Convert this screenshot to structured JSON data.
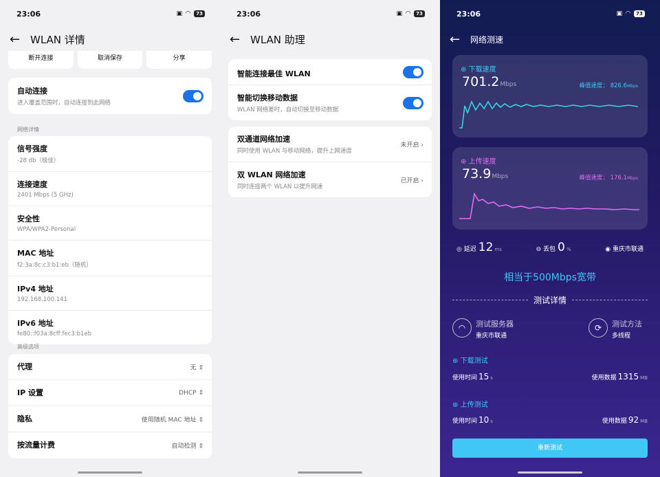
{
  "status": {
    "time": "23:06",
    "battery": "73"
  },
  "wlan_details": {
    "title": "WLAN 详情",
    "actions": [
      "断开连接",
      "取消保存",
      "分享"
    ],
    "auto_connect": {
      "title": "自动连接",
      "subtitle": "进入覆盖范围时，自动连接到此网络"
    },
    "network_section": "网络详情",
    "details": [
      {
        "title": "信号强度",
        "value": "-28 db（极佳）"
      },
      {
        "title": "连接速度",
        "value": "2401 Mbps (5 GHz)"
      },
      {
        "title": "安全性",
        "value": "WPA/WPA2-Personal"
      },
      {
        "title": "MAC 地址",
        "value": "f2:3a:8c:c3:b1:eb（随机）"
      },
      {
        "title": "IPv4 地址",
        "value": "192.168.100.141"
      },
      {
        "title": "IPv6 地址",
        "value": "fe80::f03a:8cff:fec3:b1eb"
      }
    ],
    "advanced_section": "高级选项",
    "advanced": [
      {
        "title": "代理",
        "value": "无"
      },
      {
        "title": "IP 设置",
        "value": "DHCP"
      },
      {
        "title": "隐私",
        "value": "使用随机 MAC 地址"
      },
      {
        "title": "按流量计费",
        "value": "自动检测"
      }
    ]
  },
  "wlan_assistant": {
    "title": "WLAN 助理",
    "toggles": [
      {
        "title": "智能连接最佳 WLAN",
        "subtitle": ""
      },
      {
        "title": "智能切换移动数据",
        "subtitle": "WLAN 网络差时，自动切换至移动数据"
      }
    ],
    "links": [
      {
        "title": "双通道网络加速",
        "subtitle": "同时使用 WLAN 与移动网络，提升上网速度",
        "value": "未开启"
      },
      {
        "title": "双 WLAN 网络加速",
        "subtitle": "同时连接两个 WLAN 以提升网速",
        "value": "已开启"
      }
    ]
  },
  "speed_test": {
    "title": "网络测速",
    "download": {
      "label": "下载速度",
      "value": "701.2",
      "unit": "Mbps",
      "peak_label": "峰值速度：",
      "peak": "826.6",
      "peak_unit": "Mbps"
    },
    "upload": {
      "label": "上传速度",
      "value": "73.9",
      "unit": "Mbps",
      "peak_label": "峰值速度：",
      "peak": "176.1",
      "peak_unit": "Mbps"
    },
    "latency": {
      "label": "延迟",
      "value": "12",
      "unit": "ms"
    },
    "loss": {
      "label": "丢包",
      "value": "0",
      "unit": "%"
    },
    "isp": "重庆市联通",
    "equivalent": "相当于500Mbps宽带",
    "details_title": "测试详情",
    "server_label": "测试服务器",
    "server": "重庆市联通",
    "method_label": "测试方法",
    "method": "多线程",
    "download_test": {
      "label": "下载测试",
      "time_label": "使用时间",
      "time": "15",
      "time_unit": "s",
      "data_label": "使用数据",
      "data": "1315",
      "data_unit": "MB"
    },
    "upload_test": {
      "label": "上传测试",
      "time_label": "使用时间",
      "time": "10",
      "time_unit": "s",
      "data_label": "使用数据",
      "data": "92",
      "data_unit": "MB"
    },
    "retest": "重新测试",
    "colors": {
      "download_line": "#3fd0e8",
      "upload_line": "#e06cf0",
      "accent": "#41c7f5"
    }
  }
}
